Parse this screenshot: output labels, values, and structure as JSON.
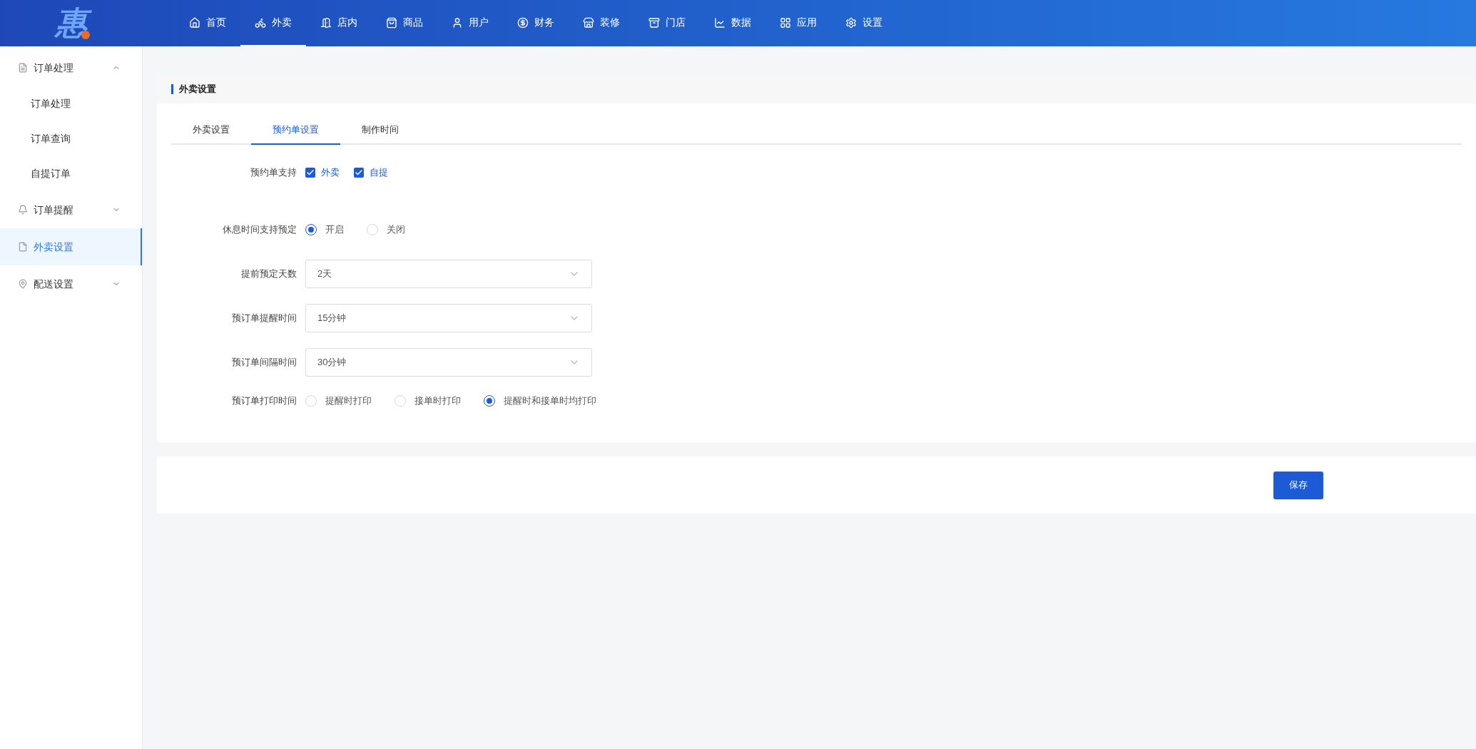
{
  "logo": {
    "text": "惠"
  },
  "nav": [
    {
      "label": "首页",
      "selected": false
    },
    {
      "label": "外卖",
      "selected": true
    },
    {
      "label": "店内",
      "selected": false
    },
    {
      "label": "商品",
      "selected": false
    },
    {
      "label": "用户",
      "selected": false
    },
    {
      "label": "财务",
      "selected": false
    },
    {
      "label": "装修",
      "selected": false
    },
    {
      "label": "门店",
      "selected": false
    },
    {
      "label": "数据",
      "selected": false
    },
    {
      "label": "应用",
      "selected": false
    },
    {
      "label": "设置",
      "selected": false
    }
  ],
  "sidebar": {
    "items": [
      {
        "kind": "group",
        "label": "订单处理",
        "expanded": true,
        "children": [
          {
            "label": "订单处理",
            "selected": false
          },
          {
            "label": "订单查询",
            "selected": false
          },
          {
            "label": "自提订单",
            "selected": false
          }
        ]
      },
      {
        "kind": "group",
        "label": "订单提醒",
        "expanded": false
      },
      {
        "kind": "link",
        "label": "外卖设置",
        "selected": true
      },
      {
        "kind": "group",
        "label": "配送设置",
        "expanded": false
      }
    ]
  },
  "panel": {
    "title": "外卖设置",
    "tabs": [
      {
        "label": "外卖设置",
        "selected": false
      },
      {
        "label": "预约单设置",
        "selected": true
      },
      {
        "label": "制作时间",
        "selected": false
      }
    ],
    "rows": [
      {
        "kind": "checkbox",
        "label": "预约单支持",
        "options": [
          {
            "label": "外卖",
            "checked": true
          },
          {
            "label": "自提",
            "checked": true
          }
        ]
      },
      {
        "kind": "radio",
        "label": "休息时间支持预定",
        "options": [
          {
            "label": "开启",
            "selected": true
          },
          {
            "label": "关闭",
            "selected": false
          }
        ]
      },
      {
        "kind": "select",
        "label": "提前预定天数",
        "value": "2天"
      },
      {
        "kind": "select",
        "label": "预订单提醒时间",
        "value": "15分钟"
      },
      {
        "kind": "select",
        "label": "预订单间隔时间",
        "value": "30分钟"
      },
      {
        "kind": "radio",
        "label": "预订单打印时间",
        "options": [
          {
            "label": "提醒时打印",
            "selected": false
          },
          {
            "label": "接单时打印",
            "selected": false
          },
          {
            "label": "提醒时和接单时均打印",
            "selected": true
          }
        ]
      }
    ]
  },
  "save_button": "保存"
}
